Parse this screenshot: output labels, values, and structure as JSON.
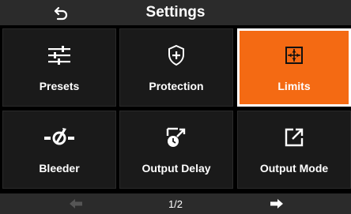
{
  "header": {
    "title": "Settings",
    "back_icon": "back-arrow-icon"
  },
  "tiles": [
    {
      "label": "Presets",
      "icon": "sliders-icon",
      "selected": false
    },
    {
      "label": "Protection",
      "icon": "shield-plus-icon",
      "selected": false
    },
    {
      "label": "Limits",
      "icon": "limits-icon",
      "selected": true
    },
    {
      "label": "Bleeder",
      "icon": "bleeder-icon",
      "selected": false
    },
    {
      "label": "Output Delay",
      "icon": "output-delay-icon",
      "selected": false
    },
    {
      "label": "Output Mode",
      "icon": "output-mode-icon",
      "selected": false
    }
  ],
  "footer": {
    "page": "1/2",
    "prev_icon": "arrow-left-icon",
    "next_icon": "arrow-right-icon"
  },
  "colors": {
    "accent": "#f46a13",
    "tile_bg": "#1a1a1a",
    "bar_bg": "#2b2b2b",
    "disabled": "#666666"
  }
}
